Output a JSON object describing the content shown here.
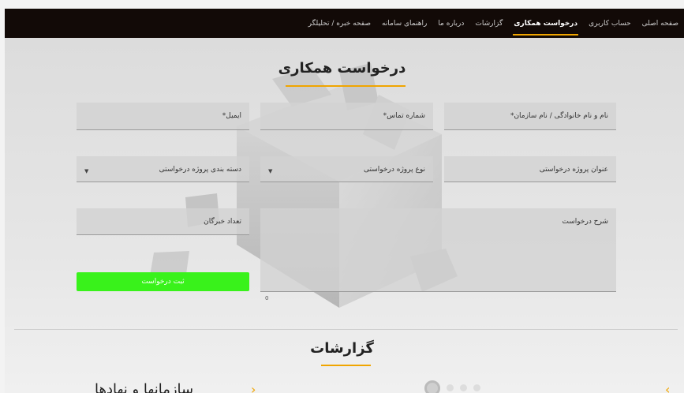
{
  "nav": {
    "items": [
      {
        "label": "صفحه اصلی",
        "active": false
      },
      {
        "label": "حساب کاربری",
        "active": false
      },
      {
        "label": "درخواست همکاری",
        "active": true
      },
      {
        "label": "گزارشات",
        "active": false
      },
      {
        "label": "درباره ما",
        "active": false
      },
      {
        "label": "راهنمای سامانه",
        "active": false
      },
      {
        "label": "صفحه خبره / تحلیلگر",
        "active": false
      }
    ]
  },
  "form": {
    "title": "درخواست همکاری",
    "name_label": "نام و نام خانوادگی / نام سازمان*",
    "phone_label": "شماره تماس*",
    "email_label": "ایمیل*",
    "project_title_label": "عنوان پروژه درخواستی",
    "project_type_label": "نوع پروژه درخواستی",
    "category_label": "دسته بندی پروژه درخواستی",
    "description_label": "شرح درخواست",
    "experts_label": "تعداد خبرگان",
    "submit_label": "ثبت درخواست",
    "char_count": "0"
  },
  "reports": {
    "title": "گزارشات",
    "card_heading": "سازمانها و نهادها"
  },
  "colors": {
    "topbar": "#120a07",
    "accent": "#f0a500",
    "submit": "#39f21b"
  },
  "icons": {
    "select_arrow": "caret-down-icon",
    "carousel_prev": "chevron-left-icon",
    "carousel_next": "chevron-right-icon"
  }
}
